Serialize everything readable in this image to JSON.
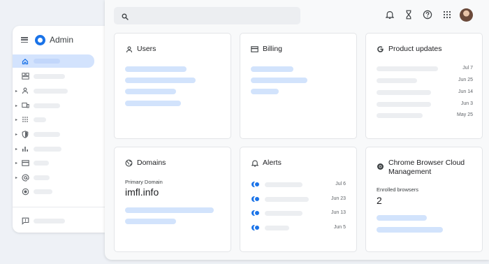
{
  "app": {
    "title": "Admin"
  },
  "search": {
    "placeholder": ""
  },
  "cards": {
    "users": {
      "title": "Users"
    },
    "billing": {
      "title": "Billing"
    },
    "product_updates": {
      "title": "Product updates",
      "dates": [
        "Jul 7",
        "Jun 25",
        "Jun 14",
        "Jun 3",
        "May 25"
      ]
    },
    "domains": {
      "title": "Domains",
      "primary_label": "Primary Domain",
      "primary_value": "imfl.info"
    },
    "alerts": {
      "title": "Alerts",
      "dates": [
        "Jul 6",
        "Jun 23",
        "Jun 13",
        "Jun 5"
      ]
    },
    "chrome": {
      "title": "Chrome Browser Cloud Management",
      "enrolled_label": "Enrolled browsers",
      "enrolled_value": "2"
    }
  },
  "colors": {
    "accent": "#1a73e8",
    "active_nav": "#d3e3fd",
    "placeholder_blue": "#d2e3fc",
    "placeholder_grey": "#eceef1"
  }
}
